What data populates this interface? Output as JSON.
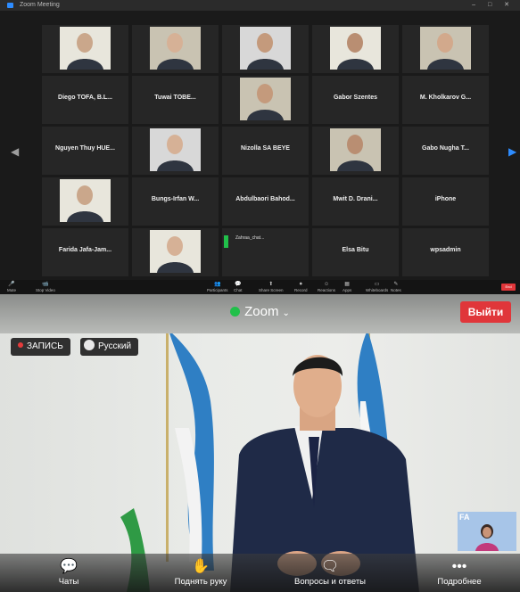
{
  "desktop": {
    "title": "Zoom Meeting",
    "tiles": [
      {
        "id": "t1",
        "name": "",
        "caption": "",
        "has_video": true
      },
      {
        "id": "t2",
        "name": "",
        "caption": "",
        "has_video": true
      },
      {
        "id": "t3",
        "name": "",
        "caption": "",
        "has_video": true
      },
      {
        "id": "t4",
        "name": "",
        "caption": "",
        "has_video": true
      },
      {
        "id": "t5",
        "name": "",
        "caption": "",
        "has_video": true
      },
      {
        "id": "t6",
        "name": "Diego TOFA, B.L...",
        "caption": "",
        "has_video": false
      },
      {
        "id": "t7",
        "name": "Tuwai TOBE...",
        "caption": "",
        "has_video": false
      },
      {
        "id": "t8",
        "name": "",
        "caption": "",
        "has_video": true
      },
      {
        "id": "t9",
        "name": "Gabor Szentes",
        "caption": "",
        "has_video": false
      },
      {
        "id": "t10",
        "name": "M. Kholkarov G...",
        "caption": "",
        "has_video": false
      },
      {
        "id": "t11",
        "name": "Nguyen Thuy HUE...",
        "caption": "",
        "has_video": false
      },
      {
        "id": "t12",
        "name": "",
        "caption": "",
        "has_video": true
      },
      {
        "id": "t13",
        "name": "Nizolla SA BEYE",
        "caption": "",
        "has_video": false
      },
      {
        "id": "t14",
        "name": "",
        "caption": "",
        "has_video": true
      },
      {
        "id": "t15",
        "name": "Gabo Nugha T...",
        "caption": "",
        "has_video": false
      },
      {
        "id": "t16",
        "name": "",
        "caption": "",
        "has_video": true
      },
      {
        "id": "t17",
        "name": "Bungs-Irfan W...",
        "caption": "",
        "has_video": false
      },
      {
        "id": "t18",
        "name": "Abdulbaori Bahod...",
        "caption": "",
        "has_video": false
      },
      {
        "id": "t19",
        "name": "Mwit D. Drani...",
        "caption": "",
        "has_video": false
      },
      {
        "id": "t20",
        "name": "iPhone",
        "caption": "",
        "has_video": false
      },
      {
        "id": "t21",
        "name": "Farida Jafa-Jam...",
        "caption": "",
        "has_video": false
      },
      {
        "id": "t22",
        "name": "",
        "caption": "",
        "has_video": true
      },
      {
        "id": "t23",
        "name": "",
        "caption": "",
        "has_video": false
      },
      {
        "id": "t24",
        "name": "Elsa Bitu",
        "caption": "",
        "has_video": false
      },
      {
        "id": "t25",
        "name": "wpsadmin",
        "caption": "",
        "has_video": false
      }
    ],
    "chat_preview": "Zahraa_chat...",
    "toolbar": [
      "Mute",
      "Stop Video",
      "",
      "Participants",
      "Chat",
      "Share Screen",
      "Record",
      "Reactions",
      "Apps",
      "Whiteboards",
      "Notes"
    ],
    "end_label": "End"
  },
  "mobile": {
    "title": "Zoom",
    "exit_label": "Выйти",
    "record_label": "ЗАПИСЬ",
    "language_label": "Русский",
    "thumb_label": "FA",
    "toolbar": {
      "chats": "Чаты",
      "raise_hand": "Поднять руку",
      "qa": "Вопросы и ответы",
      "more": "Подробнее"
    },
    "colors": {
      "accent_red": "#e0363a",
      "live_green": "#21c04a"
    }
  }
}
